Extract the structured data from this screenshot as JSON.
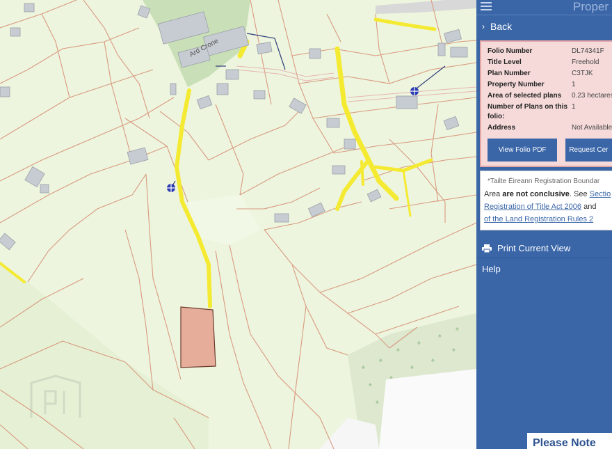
{
  "app": {
    "title": "Proper"
  },
  "nav": {
    "back_label": "Back"
  },
  "folio": {
    "rows": [
      {
        "key": "Folio Number",
        "value": "DL74341F"
      },
      {
        "key": "Title Level",
        "value": "Freehold"
      },
      {
        "key": "Plan Number",
        "value": "C3TJK"
      },
      {
        "key": "Property Number",
        "value": "1"
      },
      {
        "key": "Area of selected plans",
        "value": "0.23 hectares"
      },
      {
        "key": "Number of Plans on this folio:",
        "value": "1"
      },
      {
        "key": "Address",
        "value": "Not Available"
      }
    ],
    "view_pdf_label": "View Folio PDF",
    "request_cert_label": "Request Cer"
  },
  "notice": {
    "line1": "*Tailte Éireann Registration Boundar",
    "line2_pre": "Area ",
    "line2_bold": "are not conclusive",
    "line2_mid": ". See ",
    "line2_link": "Sectio",
    "line3_link": "Registration of Title Act 2006",
    "line3_post": " and",
    "line4_link": "of the Land Registration Rules 2"
  },
  "menu": {
    "print_label": "Print Current View",
    "help_label": "Help"
  },
  "footer": {
    "please_note": "Please Note"
  },
  "map": {
    "street_label": "Ard Crone",
    "colors": {
      "parcel_fill": "#e7ad9b",
      "road_yellow": "#f5ea32",
      "boundary": "#d99a80",
      "background": "#edf5de"
    }
  }
}
